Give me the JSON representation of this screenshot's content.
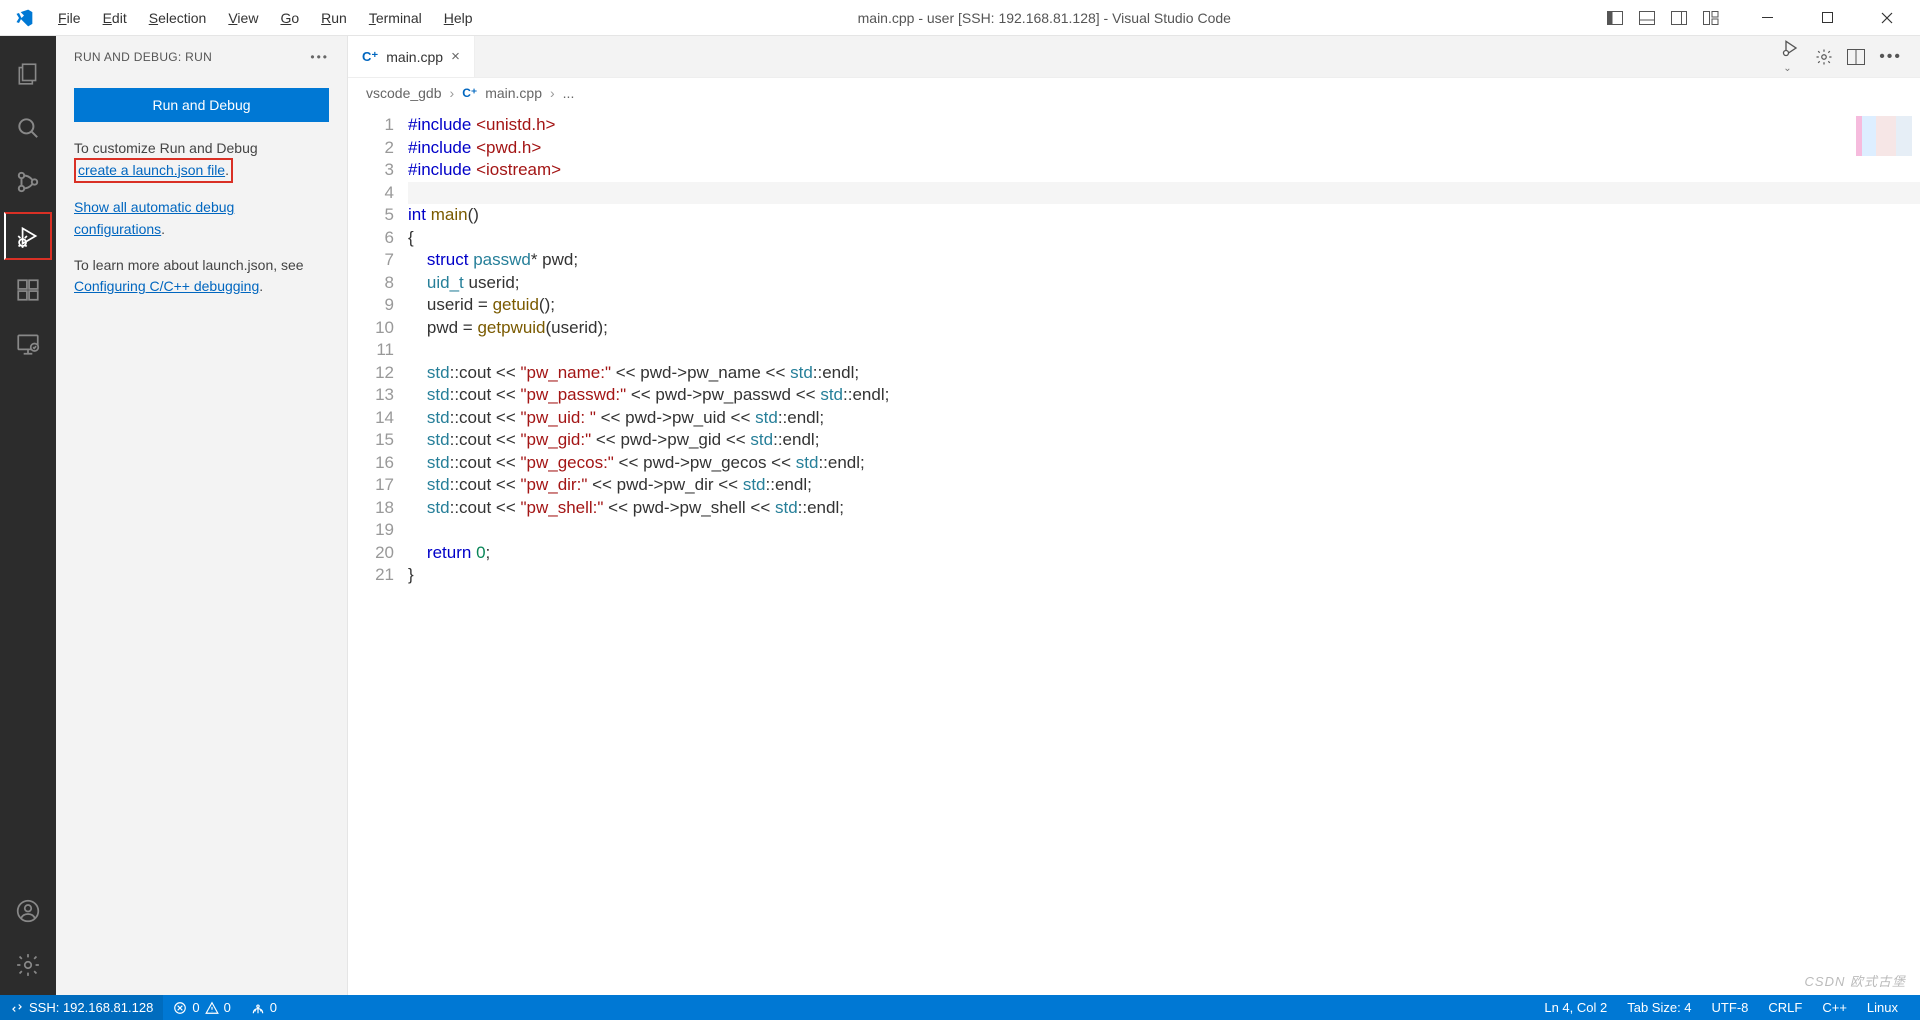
{
  "menu": [
    "File",
    "Edit",
    "Selection",
    "View",
    "Go",
    "Run",
    "Terminal",
    "Help"
  ],
  "title": "main.cpp - user [SSH: 192.168.81.128] - Visual Studio Code",
  "sidebar": {
    "header": "RUN AND DEBUG: RUN",
    "run_btn": "Run and Debug",
    "p1_a": "To customize Run and Debug",
    "p1_link": "create a launch.json file",
    "p1_end": ".",
    "p2_link": "Show all automatic debug configurations",
    "p2_end": ".",
    "p3_a": "To learn more about launch.json, see ",
    "p3_link": "Configuring C/C++ debugging",
    "p3_end": "."
  },
  "tab": {
    "name": "main.cpp"
  },
  "breadcrumb": {
    "folder": "vscode_gdb",
    "file": "main.cpp",
    "more": "..."
  },
  "code": [
    {
      "n": 1,
      "html": "<span class='pp'>#include</span> <span class='str'>&lt;unistd.h&gt;</span>"
    },
    {
      "n": 2,
      "html": "<span class='pp'>#include</span> <span class='str'>&lt;pwd.h&gt;</span>"
    },
    {
      "n": 3,
      "html": "<span class='pp'>#include</span> <span class='str'>&lt;iostream&gt;</span>"
    },
    {
      "n": 4,
      "html": "",
      "hl": true
    },
    {
      "n": 5,
      "html": "<span class='kw'>int</span> <span class='fn'>main</span>()"
    },
    {
      "n": 6,
      "html": "{"
    },
    {
      "n": 7,
      "html": "    <span class='kw'>struct</span> <span class='ns'>passwd</span>* pwd;"
    },
    {
      "n": 8,
      "html": "    <span class='ns'>uid_t</span> userid;"
    },
    {
      "n": 9,
      "html": "    userid = <span class='fn'>getuid</span>();"
    },
    {
      "n": 10,
      "html": "    pwd = <span class='fn'>getpwuid</span>(userid);"
    },
    {
      "n": 11,
      "html": ""
    },
    {
      "n": 12,
      "html": "    <span class='ns'>std</span>::cout &lt;&lt; <span class='str'>\"pw_name:\"</span> &lt;&lt; pwd-&gt;pw_name &lt;&lt; <span class='ns'>std</span>::endl;"
    },
    {
      "n": 13,
      "html": "    <span class='ns'>std</span>::cout &lt;&lt; <span class='str'>\"pw_passwd:\"</span> &lt;&lt; pwd-&gt;pw_passwd &lt;&lt; <span class='ns'>std</span>::endl;"
    },
    {
      "n": 14,
      "html": "    <span class='ns'>std</span>::cout &lt;&lt; <span class='str'>\"pw_uid: \"</span> &lt;&lt; pwd-&gt;pw_uid &lt;&lt; <span class='ns'>std</span>::endl;"
    },
    {
      "n": 15,
      "html": "    <span class='ns'>std</span>::cout &lt;&lt; <span class='str'>\"pw_gid:\"</span> &lt;&lt; pwd-&gt;pw_gid &lt;&lt; <span class='ns'>std</span>::endl;"
    },
    {
      "n": 16,
      "html": "    <span class='ns'>std</span>::cout &lt;&lt; <span class='str'>\"pw_gecos:\"</span> &lt;&lt; pwd-&gt;pw_gecos &lt;&lt; <span class='ns'>std</span>::endl;"
    },
    {
      "n": 17,
      "html": "    <span class='ns'>std</span>::cout &lt;&lt; <span class='str'>\"pw_dir:\"</span> &lt;&lt; pwd-&gt;pw_dir &lt;&lt; <span class='ns'>std</span>::endl;"
    },
    {
      "n": 18,
      "html": "    <span class='ns'>std</span>::cout &lt;&lt; <span class='str'>\"pw_shell:\"</span> &lt;&lt; pwd-&gt;pw_shell &lt;&lt; <span class='ns'>std</span>::endl;"
    },
    {
      "n": 19,
      "html": ""
    },
    {
      "n": 20,
      "html": "    <span class='kw'>return</span> <span class='num'>0</span>;"
    },
    {
      "n": 21,
      "html": "}"
    }
  ],
  "status": {
    "remote": "SSH: 192.168.81.128",
    "err": "0",
    "warn": "0",
    "ports": "0",
    "ln": "Ln 4, Col 2",
    "tab": "Tab Size: 4",
    "enc": "UTF-8",
    "eol": "CRLF",
    "lang": "C++",
    "os": "Linux"
  },
  "watermark": "CSDN 欧式古堡"
}
